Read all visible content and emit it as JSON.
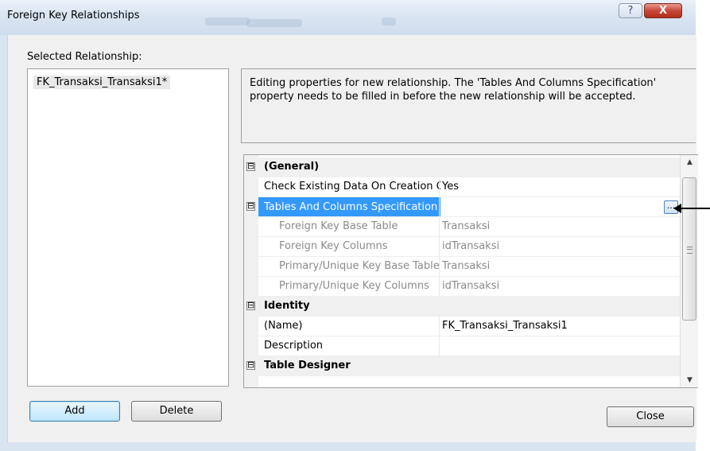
{
  "window": {
    "title": "Foreign Key Relationships",
    "help_glyph": "?",
    "close_glyph": "X"
  },
  "selected_relationship": {
    "label": "Selected Relationship:",
    "items": [
      "FK_Transaksi_Transaksi1*"
    ]
  },
  "description": "Editing properties for new relationship.  The 'Tables And Columns Specification' property needs to be filled in before the new relationship will be accepted.",
  "property_grid": {
    "rows": [
      {
        "kind": "category",
        "name": "(General)",
        "value": "",
        "expander": "⊟"
      },
      {
        "kind": "prop",
        "name": "Check Existing Data On Creation Or Re-Enabling",
        "value": "Yes"
      },
      {
        "kind": "selected",
        "name": "Tables And Columns Specification",
        "value": "",
        "expander": "⊟",
        "button": "..."
      },
      {
        "kind": "sub",
        "name": "Foreign Key Base Table",
        "value": "Transaksi"
      },
      {
        "kind": "sub",
        "name": "Foreign Key Columns",
        "value": "idTransaksi"
      },
      {
        "kind": "sub",
        "name": "Primary/Unique Key Base Table",
        "value": "Transaksi"
      },
      {
        "kind": "sub",
        "name": "Primary/Unique Key Columns",
        "value": "idTransaksi"
      },
      {
        "kind": "category",
        "name": "Identity",
        "value": "",
        "expander": "⊟"
      },
      {
        "kind": "prop",
        "name": "(Name)",
        "value": "FK_Transaksi_Transaksi1"
      },
      {
        "kind": "prop",
        "name": "Description",
        "value": ""
      },
      {
        "kind": "category",
        "name": "Table Designer",
        "value": "",
        "expander": "⊟"
      }
    ]
  },
  "buttons": {
    "add": "Add",
    "delete": "Delete",
    "close": "Close"
  },
  "colors": {
    "selection": "#3399ff",
    "dialog_bg": "#f0f0f0"
  }
}
